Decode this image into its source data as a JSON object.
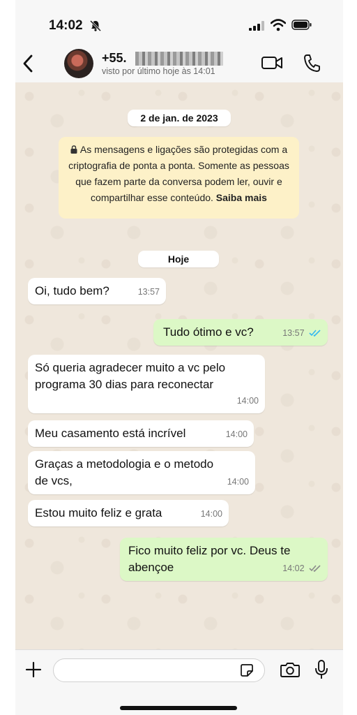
{
  "status_bar": {
    "time": "14:02"
  },
  "header": {
    "contact_name": "+55.",
    "last_seen": "visto por último hoje às 14:01"
  },
  "chat": {
    "date_label": "2 de jan. de 2023",
    "encryption_notice": "As mensagens e ligações são protegidas com a criptografia de ponta a ponta. Somente as pessoas que fazem parte da conversa podem ler, ouvir e compartilhar esse conteúdo.",
    "encryption_link": "Saiba mais",
    "today_label": "Hoje",
    "messages": [
      {
        "direction": "in",
        "text": "Oi, tudo bem?",
        "time": "13:57"
      },
      {
        "direction": "out",
        "text": "Tudo ótimo e vc?",
        "time": "13:57",
        "status": "read"
      },
      {
        "direction": "in",
        "text": "Só queria agradecer muito a vc pelo programa 30 dias para reconectar",
        "time": "14:00"
      },
      {
        "direction": "in",
        "text": "Meu casamento está incrível",
        "time": "14:00"
      },
      {
        "direction": "in",
        "text": "Graças a metodologia e o metodo de vcs,",
        "time": "14:00"
      },
      {
        "direction": "in",
        "text": "Estou muito feliz e grata",
        "time": "14:00"
      },
      {
        "direction": "out",
        "text": "Fico muito feliz por vc. Deus te abençoe",
        "time": "14:02",
        "status": "delivered"
      }
    ]
  },
  "colors": {
    "incoming_bubble": "#ffffff",
    "outgoing_bubble": "#dcf8c6",
    "read_ticks": "#34b7f1",
    "delivered_ticks": "#8a8a8a",
    "encryption_notice_bg": "#fdf1c8"
  },
  "icons": [
    "back-arrow-icon",
    "video-call-icon",
    "phone-icon",
    "plus-icon",
    "sticker-icon",
    "camera-icon",
    "microphone-icon",
    "lock-icon",
    "bell-muted-icon",
    "signal-icon",
    "wifi-icon",
    "battery-icon"
  ]
}
